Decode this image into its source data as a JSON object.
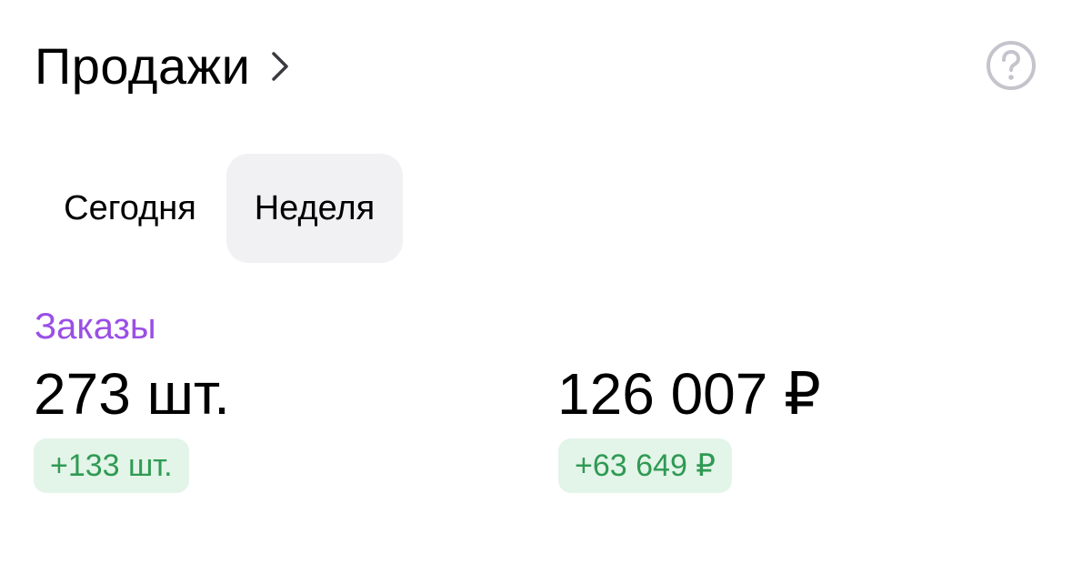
{
  "header": {
    "title": "Продажи",
    "chevron_icon": "chevron-right-icon",
    "help_icon": "question-circle-icon"
  },
  "period_tabs": {
    "items": [
      {
        "label": "Сегодня",
        "selected": false
      },
      {
        "label": "Неделя",
        "selected": true
      }
    ]
  },
  "orders": {
    "label": "Заказы",
    "quantity": "273 шт.",
    "quantity_delta": "+133 шт.",
    "amount": "126 007 ₽",
    "amount_delta": "+63 649 ₽"
  },
  "colors": {
    "accent_purple": "#9a4fe5",
    "positive_green": "#2f9a53",
    "positive_bg": "#e3f4e8",
    "selected_tab_bg": "#f1f1f4",
    "help_icon_gray": "#c4c4cc"
  }
}
